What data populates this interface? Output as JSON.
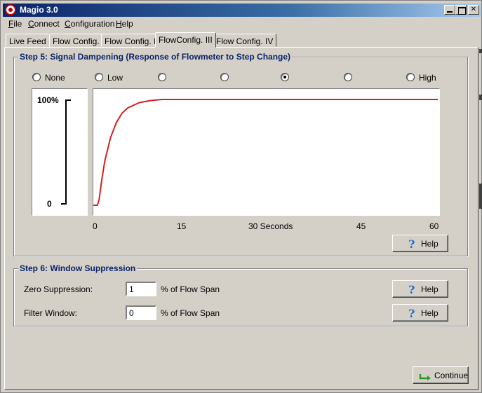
{
  "window": {
    "title": "Magio 3.0"
  },
  "menu": [
    "File",
    "Connect",
    "Configuration",
    "Help"
  ],
  "tabs": [
    "Live Feed",
    "Flow Config. I",
    "Flow Config. II",
    "FlowConfig. III",
    "Flow Config. IV"
  ],
  "active_tab": 3,
  "step5": {
    "title": "Step 5: Signal Dampening (Response of Flowmeter to Step Change)",
    "radios": [
      {
        "label": "None",
        "checked": false
      },
      {
        "label": "Low",
        "checked": false
      },
      {
        "label": "",
        "checked": false
      },
      {
        "label": "",
        "checked": false
      },
      {
        "label": "",
        "checked": true
      },
      {
        "label": "",
        "checked": false
      },
      {
        "label": "High",
        "checked": false
      }
    ],
    "scale": {
      "top_label": "100%",
      "bottom_label": "0"
    },
    "x_axis": [
      "0",
      "15",
      "30 Seconds",
      "45",
      "60"
    ],
    "help_label": "Help"
  },
  "chart_data": {
    "type": "line",
    "x": [
      0,
      0.7,
      1,
      1.5,
      2,
      3,
      4,
      5,
      6,
      8,
      10,
      12,
      15,
      20,
      30,
      45,
      60
    ],
    "series": [
      {
        "values": [
          0,
          0,
          5,
          25,
          42,
          64,
          78,
          87,
          92,
          97,
          99,
          100,
          100,
          100,
          100,
          100,
          100
        ],
        "color": "#d42020"
      }
    ],
    "xlim": [
      0,
      60
    ],
    "ylim": [
      0,
      100
    ],
    "x_ticks": [
      "0",
      "15",
      "30 Seconds",
      "45",
      "60"
    ],
    "y_ticks": [
      "0",
      "100%"
    ],
    "grid": false
  },
  "step6": {
    "title": "Step 6: Window Suppression",
    "rows": [
      {
        "label": "Zero Suppression:",
        "value": "1",
        "unit": "% of Flow Span",
        "help": "Help"
      },
      {
        "label": "Filter Window:",
        "value": "0",
        "unit": "% of Flow Span",
        "help": "Help"
      }
    ]
  },
  "continue_label": "Continue",
  "colors": {
    "title_bar": "#0a246a",
    "accent": "#0a246a",
    "curve": "#d42020",
    "help_icon": "#1c6fd1",
    "continue_icon": "#2a9a2a"
  }
}
